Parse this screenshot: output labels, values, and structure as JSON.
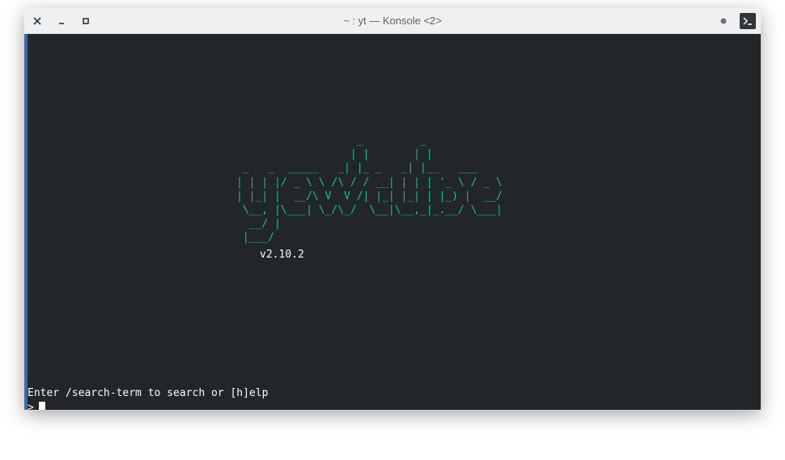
{
  "window": {
    "title": "~ : yt — Konsole <2>"
  },
  "titlebar": {
    "close_icon": "close-icon",
    "minimize_icon": "minimize-icon",
    "maximize_icon": "maximize-icon",
    "pin_icon": "dot-icon",
    "app_icon": "terminal-icon"
  },
  "terminal": {
    "logo_lines": [
      "                   _         _",
      "                  | |       | |",
      " _   _  _____   _| |_ _   _| |__   ___",
      "| | | |/ _ \\ \\ /\\ / / __| | | | '_ \\ / _ \\",
      "| |_| |  __/\\ V  V /| |_| |_| | |_) |  __/",
      " \\__, |\\___| \\_/\\_/  \\__|\\__,_|_.__/ \\___|",
      "  __/ |",
      " |___/"
    ],
    "version": "v2.10.2",
    "help_text": "Enter /search-term to search or [h]elp",
    "prompt": ">"
  },
  "colors": {
    "terminal_bg": "#232629",
    "logo_green": "#1abc9c",
    "text": "#fcfcfc",
    "titlebar_bg": "#eff0f1",
    "focus_border": "#3d6aa0"
  }
}
